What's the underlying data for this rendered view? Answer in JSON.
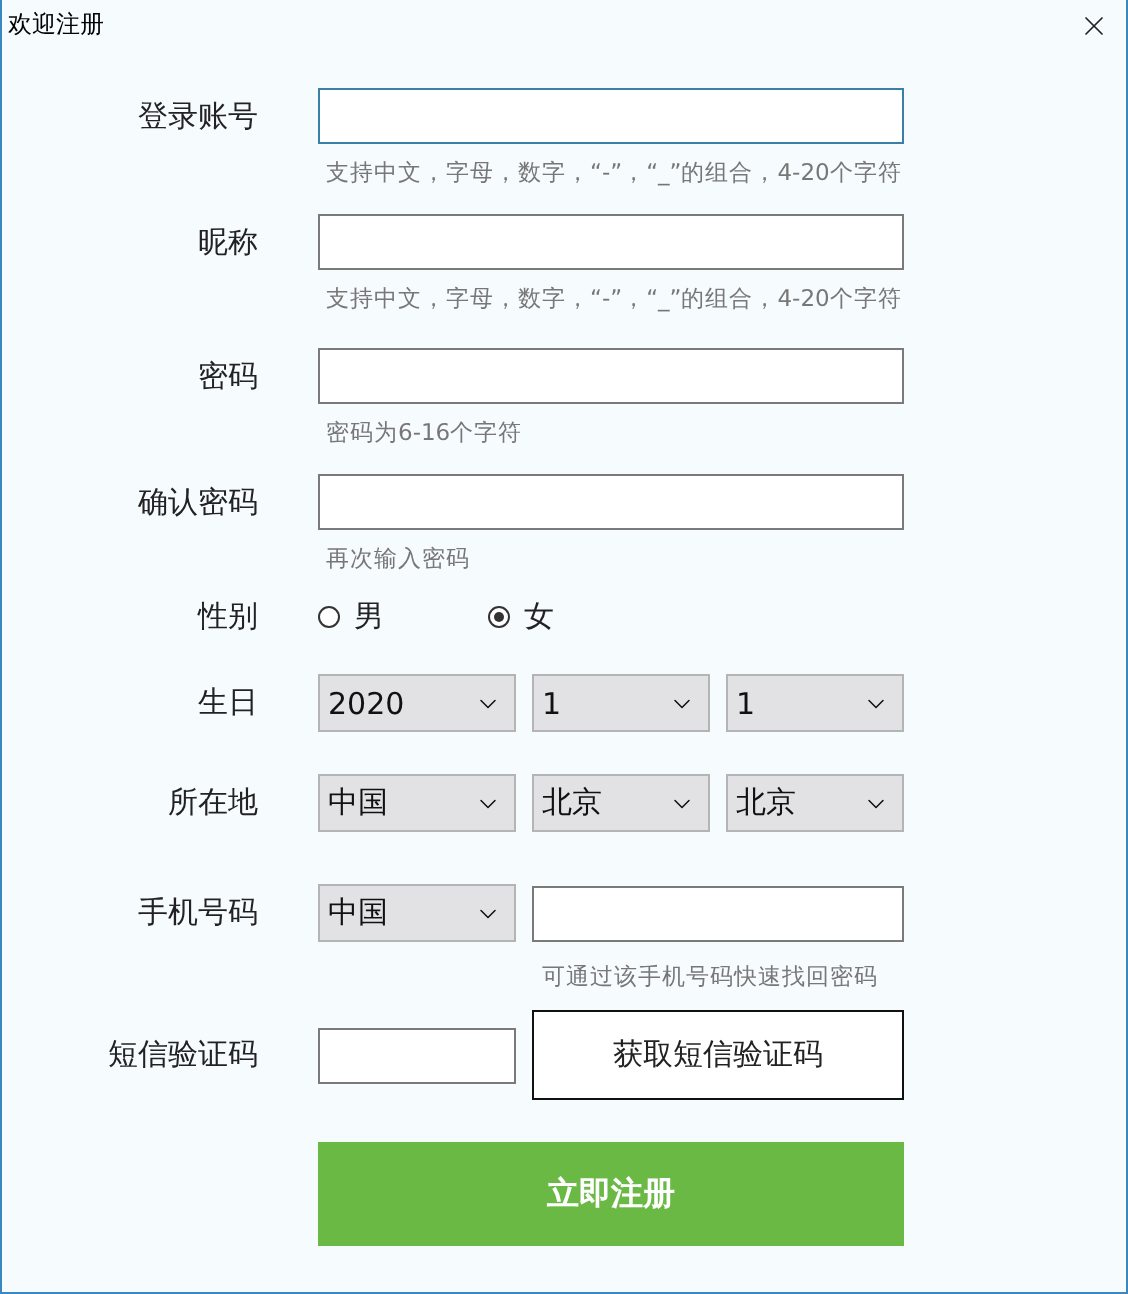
{
  "window": {
    "title": "欢迎注册"
  },
  "form": [
    {
      "kind": "text",
      "label": "登录账号",
      "focused": true,
      "hint": "支持中文，字母，数字，“-”，“_”的组合，4-20个字符"
    },
    {
      "kind": "text",
      "label": "昵称",
      "focused": false,
      "hint": "支持中文，字母，数字，“-”，“_”的组合，4-20个字符"
    },
    {
      "kind": "text",
      "label": "密码",
      "focused": false,
      "hint": "密码为6-16个字符"
    },
    {
      "kind": "text",
      "label": "确认密码",
      "focused": false,
      "hint": "再次输入密码"
    },
    {
      "kind": "radio",
      "label": "性别",
      "options": [
        {
          "label": "男",
          "selected": false
        },
        {
          "label": "女",
          "selected": true
        }
      ]
    },
    {
      "kind": "selects",
      "label": "生日",
      "selects": [
        "2020",
        "1",
        "1"
      ]
    },
    {
      "kind": "selects",
      "label": "所在地",
      "selects": [
        "中国",
        "北京",
        "北京"
      ]
    },
    {
      "kind": "phone",
      "label": "手机号码",
      "select": "中国",
      "hint": "可通过该手机号码快速找回密码"
    },
    {
      "kind": "sms",
      "label": "短信验证码",
      "button": "获取短信验证码"
    }
  ],
  "submit": "立即注册"
}
